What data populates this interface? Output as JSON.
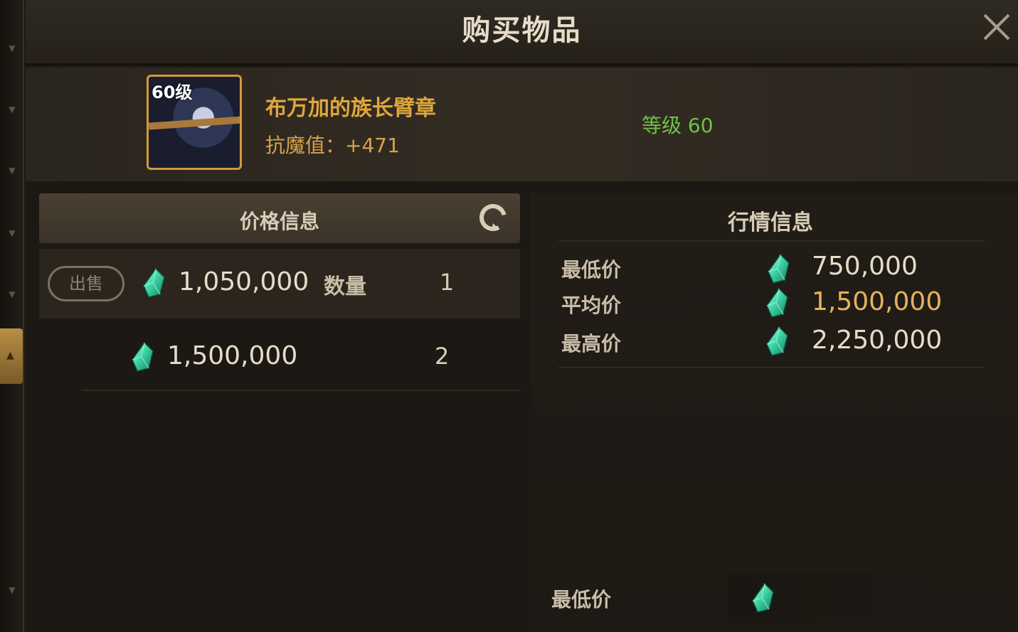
{
  "window": {
    "title": "购买物品"
  },
  "item": {
    "level_badge": "60级",
    "name": "布万加的族长臂章",
    "stat": "抗魔值：+471",
    "level_text": "等级 60"
  },
  "price_panel": {
    "title": "价格信息",
    "sell_label": "出售",
    "qty_label": "数量",
    "listings": [
      {
        "price": "1,050,000",
        "qty": "1"
      },
      {
        "price": "1,500,000",
        "qty": "2"
      }
    ]
  },
  "market_panel": {
    "title": "行情信息",
    "stats": [
      {
        "label": "最低价",
        "value": "750,000"
      },
      {
        "label": "平均价",
        "value": "1,500,000"
      },
      {
        "label": "最高价",
        "value": "2,250,000"
      }
    ],
    "bottom_label": "最低价",
    "bottom_value": ""
  },
  "colors": {
    "gold_text": "#e0a63c",
    "green_level": "#6fc248",
    "avg_price": "#e3b45a",
    "gem": "#3fd6a6"
  },
  "icons": [
    "close-icon",
    "refresh-icon",
    "gem-icon",
    "chevron-down-icon",
    "chevron-up-icon"
  ]
}
